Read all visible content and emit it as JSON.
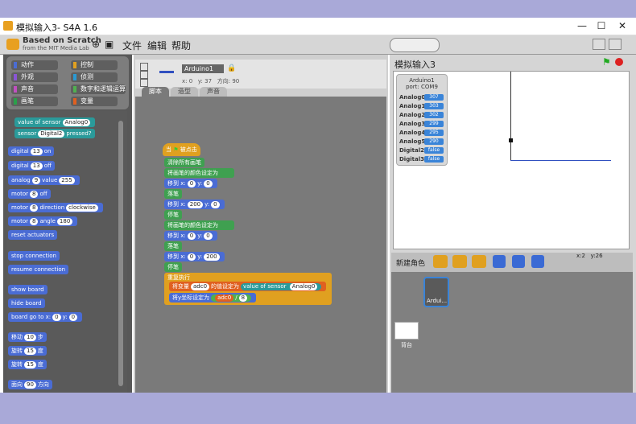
{
  "titlebar": {
    "title": "模拟输入3- S4A 1.6",
    "min": "—",
    "max": "☐",
    "close": "✕"
  },
  "menubar": {
    "logo_line1": "Based on Scratch",
    "logo_line2": "from the MIT Media Lab",
    "file": "文件",
    "edit": "编辑",
    "help": "帮助"
  },
  "categories": [
    {
      "label": "动作",
      "color": "#4a6cd4"
    },
    {
      "label": "控制",
      "color": "#e0a020"
    },
    {
      "label": "外观",
      "color": "#8a55d7"
    },
    {
      "label": "侦测",
      "color": "#2a9ad4"
    },
    {
      "label": "声音",
      "color": "#c050c0"
    },
    {
      "label": "数字和逻辑运算",
      "color": "#50b050"
    },
    {
      "label": "画笔",
      "color": "#2aa04a"
    },
    {
      "label": "变量",
      "color": "#e06020"
    }
  ],
  "palette": {
    "value_of_sensor": "value of sensor",
    "analog0": "Analog0",
    "sensor": "sensor",
    "digital2": "Digital2",
    "pressed": "pressed?",
    "digital": "digital",
    "d13": "13",
    "on": "on",
    "off": "off",
    "analog": "analog",
    "a9": "9",
    "value": "value",
    "v255": "255",
    "motor": "motor",
    "m8": "8",
    "off2": "off",
    "direction": "direction",
    "clockwise": "clockwise",
    "angle": "angle",
    "a180": "180",
    "reset": "reset actuators",
    "stop": "stop connection",
    "resume": "resume connection",
    "show_board": "show board",
    "hide_board": "hide board",
    "board_goto": "board go to x:",
    "zero": "0",
    "y": "y:",
    "move": "移动",
    "steps": "步",
    "move_n": "10",
    "turn": "旋转",
    "deg": "度",
    "turn_n": "15",
    "face": "面向",
    "face_n": "90",
    "dir": "方向"
  },
  "sprite": {
    "name": "Arduino1",
    "x_label": "x:",
    "x": "0",
    "y_label": "y:",
    "y": "37",
    "dir_label": "方向:",
    "dir": "90"
  },
  "tabs": [
    "脚本",
    "造型",
    "声音"
  ],
  "script": {
    "hat": "当",
    "hat2": "被点击",
    "clear": "清除所有画笔",
    "set_color": "将画笔的颜色设定为",
    "goto": "移到 x:",
    "gx": "0",
    "gy_label": "y:",
    "gy": "0",
    "pen_down": "落笔",
    "goto2x": "200",
    "pen_up": "停笔",
    "goto3x": "0",
    "goto3y": "0",
    "goto4x": "0",
    "goto4y": "200",
    "forever": "重复执行",
    "set_var": "将变量",
    "var": "adc0",
    "set_to": "的值设定为",
    "sensor": "value of sensor",
    "sensor_arg": "Analog0",
    "set_y": "将y坐标设定为",
    "div": "/",
    "div_n": "8"
  },
  "stage": {
    "title": "模拟输入3",
    "x_label": "x:",
    "x": "2",
    "y_label": "y:",
    "y": "26"
  },
  "monitor": {
    "title1": "Arduino1",
    "title2": "port: COM9",
    "rows": [
      {
        "label": "Analog0",
        "value": "307"
      },
      {
        "label": "Analog1",
        "value": "303"
      },
      {
        "label": "Analog2",
        "value": "302"
      },
      {
        "label": "Analog3",
        "value": "299"
      },
      {
        "label": "Analog4",
        "value": "295"
      },
      {
        "label": "Analog5",
        "value": "290"
      },
      {
        "label": "Digital2",
        "value": "false"
      },
      {
        "label": "Digital3",
        "value": "false"
      }
    ]
  },
  "spritebar": {
    "label": "新建角色"
  },
  "spritelist": {
    "sprite1": "Ardui...",
    "stage_label": "背台"
  }
}
